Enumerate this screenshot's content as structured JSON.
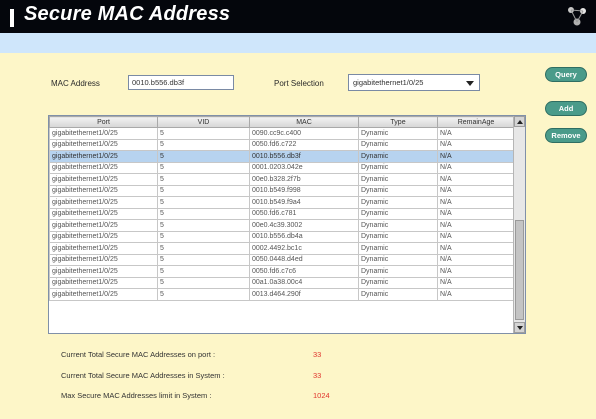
{
  "window": {
    "title": "Secure MAC Address"
  },
  "form": {
    "mac_label": "MAC Address",
    "mac_value": "0010.b556.db3f",
    "port_label": "Port Selection",
    "port_value": "gigabitethernet1/0/25"
  },
  "buttons": {
    "query": "Query",
    "add": "Add",
    "remove": "Remove"
  },
  "table": {
    "headers": [
      "Port",
      "VID",
      "MAC",
      "Type",
      "RemainAge"
    ],
    "rows": [
      [
        "gigabitethernet1/0/25",
        "5",
        "0090.cc9c.c400",
        "Dynamic",
        "N/A"
      ],
      [
        "gigabitethernet1/0/25",
        "5",
        "0050.fd6.c722",
        "Dynamic",
        "N/A"
      ],
      [
        "gigabitethernet1/0/25",
        "5",
        "0010.b556.db3f",
        "Dynamic",
        "N/A"
      ],
      [
        "gigabitethernet1/0/25",
        "5",
        "0001.0203.042e",
        "Dynamic",
        "N/A"
      ],
      [
        "gigabitethernet1/0/25",
        "5",
        "00e0.b328.2f7b",
        "Dynamic",
        "N/A"
      ],
      [
        "gigabitethernet1/0/25",
        "5",
        "0010.b549.f998",
        "Dynamic",
        "N/A"
      ],
      [
        "gigabitethernet1/0/25",
        "5",
        "0010.b549.f9a4",
        "Dynamic",
        "N/A"
      ],
      [
        "gigabitethernet1/0/25",
        "5",
        "0050.fd6.c781",
        "Dynamic",
        "N/A"
      ],
      [
        "gigabitethernet1/0/25",
        "5",
        "00e0.4c39.3002",
        "Dynamic",
        "N/A"
      ],
      [
        "gigabitethernet1/0/25",
        "5",
        "0010.b556.db4a",
        "Dynamic",
        "N/A"
      ],
      [
        "gigabitethernet1/0/25",
        "5",
        "0002.4492.bc1c",
        "Dynamic",
        "N/A"
      ],
      [
        "gigabitethernet1/0/25",
        "5",
        "0050.0448.d4ed",
        "Dynamic",
        "N/A"
      ],
      [
        "gigabitethernet1/0/25",
        "5",
        "0050.fd6.c7c6",
        "Dynamic",
        "N/A"
      ],
      [
        "gigabitethernet1/0/25",
        "5",
        "00a1.0a38.00c4",
        "Dynamic",
        "N/A"
      ],
      [
        "gigabitethernet1/0/25",
        "5",
        "0013.d464.290f",
        "Dynamic",
        "N/A"
      ]
    ],
    "selected_index": 2
  },
  "stats": {
    "port_label": "Current Total Secure MAC Addresses on port :",
    "port_value": "33",
    "system_label": "Current Total Secure MAC Addresses in System :",
    "system_value": "33",
    "max_label": "Max Secure MAC Addresses limit in System :",
    "max_value": "1024"
  },
  "colors": {
    "titlebar": "#04060c",
    "banner": "#cfe6fb",
    "content_bg": "#fdf6c8",
    "button": "#4a9b8a",
    "selected_row": "#b7d3ef",
    "stat_value": "#e0352d"
  },
  "icons": {
    "title_corner": "network-nodes-icon",
    "dropdown": "chevron-down-icon",
    "scroll_up": "scroll-up-arrow-icon",
    "scroll_down": "scroll-down-arrow-icon"
  }
}
